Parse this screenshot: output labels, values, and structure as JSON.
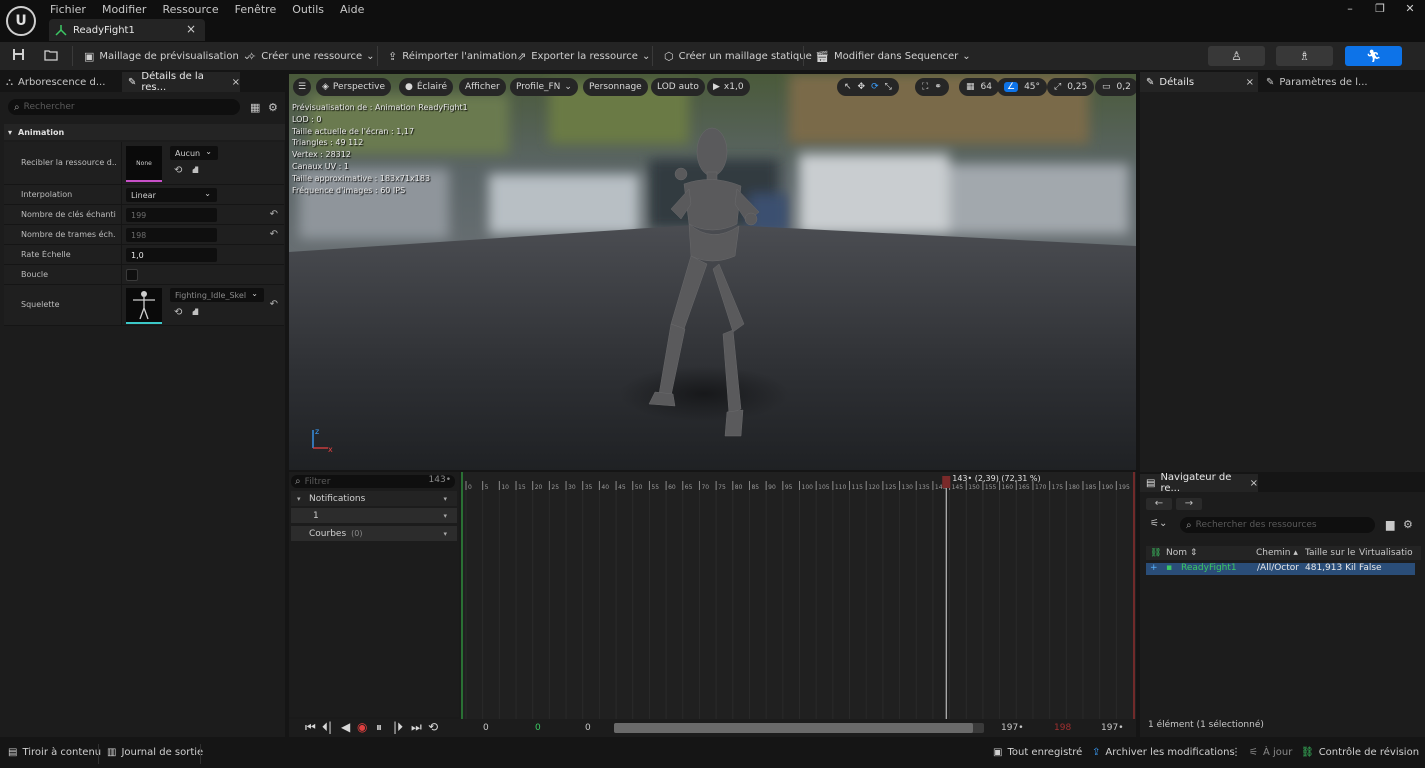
{
  "menu": [
    "Fichier",
    "Modifier",
    "Ressource",
    "Fenêtre",
    "Outils",
    "Aide"
  ],
  "document_tab": {
    "label": "ReadyFight1"
  },
  "window_controls": {
    "minimize": "–",
    "restore": "❐",
    "close": "✕"
  },
  "toolbar": {
    "preview_mesh": "Maillage de prévisualisation",
    "create_asset": "Créer une ressource",
    "reimport": "Réimporter l'animation",
    "export_asset": "Exporter la ressource",
    "create_static_mesh": "Créer un maillage statique",
    "edit_in_sequencer": "Modifier dans Sequencer"
  },
  "left_panel": {
    "tab_hierarchy": "Arborescence d...",
    "tab_details": "Détails de la res...",
    "search_placeholder": "Rechercher",
    "section": "Animation",
    "props": {
      "retarget_label": "Recibler la ressource d...",
      "retarget_thumb": "None",
      "retarget_value": "Aucun",
      "interpolation_label": "Interpolation",
      "interpolation_value": "Linear",
      "keys_label": "Nombre de clés échanti...",
      "keys_value": "199",
      "frames_label": "Nombre de trames éch...",
      "frames_value": "198",
      "rate_label": "Rate Échelle",
      "rate_value": "1,0",
      "loop_label": "Boucle",
      "skeleton_label": "Squelette",
      "skeleton_value": "Fighting_Idle_Skel"
    }
  },
  "viewport": {
    "menu_label": "☰",
    "perspective": "Perspective",
    "lit": "Éclairé",
    "show": "Afficher",
    "profile": "Profile_FN",
    "character": "Personnage",
    "lod": "LOD auto",
    "speed": "x1,0",
    "grid_size": "64",
    "angle": "45°",
    "scale": "0,25",
    "camera_speed": "0,2",
    "info": [
      "Prévisualisation de : Animation ReadyFight1",
      "LOD : 0",
      "Taille actuelle de l'écran : 1,17",
      "Triangles : 49 112",
      "Vertex : 28312",
      "Canaux UV : 1",
      "Taille approximative : 183x71x183",
      "Fréquence d'images : 60 IPS"
    ]
  },
  "right_panel": {
    "tab_details": "Détails",
    "tab_params": "Paramètres de l..."
  },
  "content_browser": {
    "tab": "Navigateur de re...",
    "search_placeholder": "Rechercher des ressources",
    "columns": [
      "Nom",
      "Chemin",
      "Taille sur le",
      "Virtualisatio"
    ],
    "row": {
      "name": "ReadyFight1",
      "path": "/All/Octor",
      "size": "481,913 Kil",
      "virtualized": "False"
    },
    "count": "1 élément (1 sélectionné)"
  },
  "timeline": {
    "filter_placeholder": "Filtrer",
    "current_frame": "143",
    "tracks": {
      "notifications": "Notifications",
      "notif_1": "1",
      "curves": "Courbes",
      "curves_count": "(0)"
    },
    "playhead_label": "143• (2,39) (72,31 %)",
    "ticks": [
      "0",
      "5",
      "10",
      "15",
      "20",
      "25",
      "30",
      "35",
      "40",
      "45",
      "50",
      "55",
      "60",
      "65",
      "70",
      "75",
      "80",
      "85",
      "90",
      "95",
      "100",
      "105",
      "110",
      "115",
      "120",
      "125",
      "130",
      "135",
      "140",
      "145",
      "150",
      "155",
      "160",
      "165",
      "170",
      "175",
      "180",
      "185",
      "190",
      "195"
    ],
    "bottom": {
      "start": "0",
      "mid": "0",
      "view_start": "0",
      "end1": "197",
      "end_red": "198",
      "end2": "197"
    },
    "playhead_fraction": 0.72
  },
  "statusbar": {
    "content_drawer": "Tiroir à contenu",
    "output_log": "Journal de sortie",
    "save_all": "Tout enregistré",
    "submit": "Archiver les modifications",
    "up_to_date": "À jour",
    "revision_control": "Contrôle de révision"
  }
}
